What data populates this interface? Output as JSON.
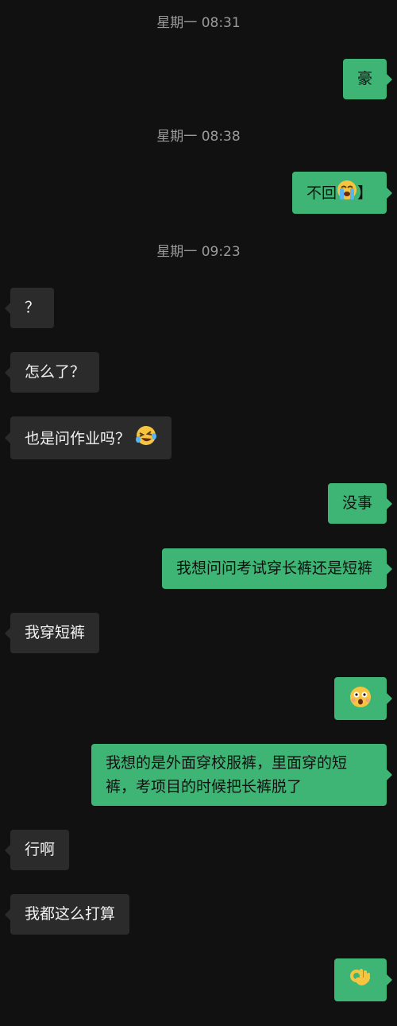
{
  "timestamps": [
    "星期一 08:31",
    "星期一 08:38",
    "星期一 09:23"
  ],
  "messages": [
    {
      "side": "me",
      "text": "豪"
    },
    {
      "side": "me",
      "text": "不回",
      "emoji": "crying-face-emoji",
      "after": "】"
    },
    {
      "side": "them",
      "text": "？"
    },
    {
      "side": "them",
      "text": "怎么了？"
    },
    {
      "side": "them",
      "text": "也是问作业吗？",
      "emoji": "laughing-tears-emoji"
    },
    {
      "side": "me",
      "text": "没事"
    },
    {
      "side": "me",
      "text": "我想问问考试穿长裤还是短裤"
    },
    {
      "side": "them",
      "text": "我穿短裤"
    },
    {
      "side": "me",
      "emoji": "surprised-face-emoji"
    },
    {
      "side": "me",
      "text": "我想的是外面穿校服裤，里面穿的短裤，考项目的时候把长裤脱了"
    },
    {
      "side": "them",
      "text": "行啊"
    },
    {
      "side": "them",
      "text": "我都这么打算"
    },
    {
      "side": "me",
      "emoji": "ok-hand-emoji"
    }
  ],
  "colors": {
    "background": "#111111",
    "my_bubble": "#3eb575",
    "their_bubble": "#2b2b2b",
    "timestamp": "#9a9a9a"
  }
}
